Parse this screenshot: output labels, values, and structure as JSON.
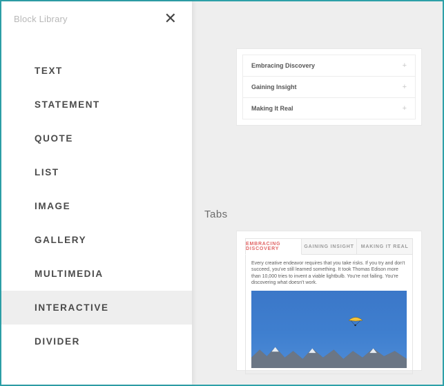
{
  "sidebar": {
    "title": "Block Library",
    "items": [
      {
        "label": "TEXT"
      },
      {
        "label": "STATEMENT"
      },
      {
        "label": "QUOTE"
      },
      {
        "label": "LIST"
      },
      {
        "label": "IMAGE"
      },
      {
        "label": "GALLERY"
      },
      {
        "label": "MULTIMEDIA"
      },
      {
        "label": "INTERACTIVE"
      },
      {
        "label": "DIVIDER"
      }
    ],
    "selected_index": 7
  },
  "accordion": {
    "rows": [
      {
        "label": "Embracing Discovery"
      },
      {
        "label": "Gaining Insight"
      },
      {
        "label": "Making It Real"
      }
    ]
  },
  "section_label": "Tabs",
  "tabs": {
    "items": [
      {
        "label": "EMBRACING DISCOVERY"
      },
      {
        "label": "GAINING INSIGHT"
      },
      {
        "label": "MAKING IT REAL"
      }
    ],
    "active_index": 0,
    "body": "Every creative endeavor requires that you take risks. If you try and don't succeed, you've still learned something. It took Thomas Edison more than 10,000 tries to invent a viable lightbulb. You're not failing. You're discovering what doesn't work."
  }
}
